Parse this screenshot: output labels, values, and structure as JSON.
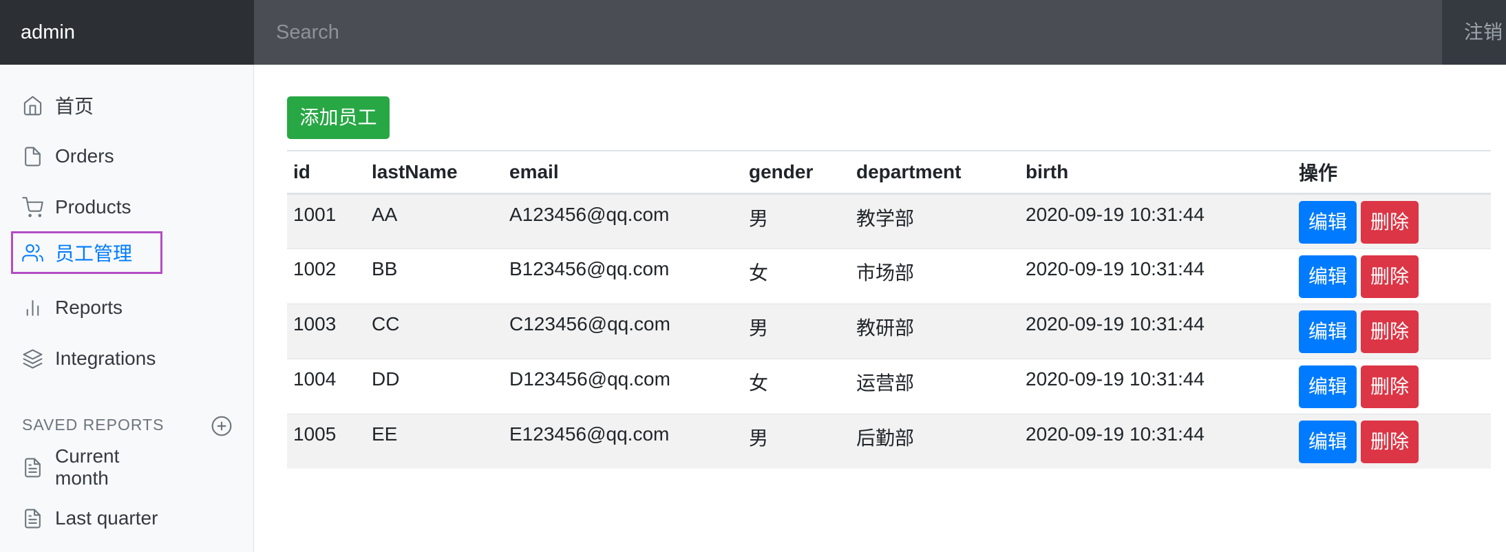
{
  "navbar": {
    "brand": "admin",
    "search_placeholder": "Search",
    "signout_label": "注销"
  },
  "sidebar": {
    "items": [
      {
        "label": "首页",
        "icon": "home-icon"
      },
      {
        "label": "Orders",
        "icon": "file-icon"
      },
      {
        "label": "Products",
        "icon": "shopping-cart-icon"
      },
      {
        "label": "员工管理",
        "icon": "users-icon",
        "active": true
      },
      {
        "label": "Reports",
        "icon": "bar-chart-icon"
      },
      {
        "label": "Integrations",
        "icon": "layers-icon"
      }
    ],
    "saved_reports_heading": "SAVED REPORTS",
    "saved_reports": [
      {
        "label": "Current month",
        "icon": "file-text-icon"
      },
      {
        "label": "Last quarter",
        "icon": "file-text-icon"
      }
    ]
  },
  "main": {
    "add_button_label": "添加员工",
    "table": {
      "columns": [
        "id",
        "lastName",
        "email",
        "gender",
        "department",
        "birth",
        "操作"
      ],
      "rows": [
        [
          "1001",
          "AA",
          "A123456@qq.com",
          "男",
          "教学部",
          "2020-09-19 10:31:44"
        ],
        [
          "1002",
          "BB",
          "B123456@qq.com",
          "女",
          "市场部",
          "2020-09-19 10:31:44"
        ],
        [
          "1003",
          "CC",
          "C123456@qq.com",
          "男",
          "教研部",
          "2020-09-19 10:31:44"
        ],
        [
          "1004",
          "DD",
          "D123456@qq.com",
          "女",
          "运营部",
          "2020-09-19 10:31:44"
        ],
        [
          "1005",
          "EE",
          "E123456@qq.com",
          "男",
          "后勤部",
          "2020-09-19 10:31:44"
        ]
      ],
      "edit_label": "编辑",
      "delete_label": "删除"
    }
  },
  "colors": {
    "accent": "#007bff",
    "success": "#28a745",
    "danger": "#dc3545",
    "active_outline": "#b44cc5"
  }
}
